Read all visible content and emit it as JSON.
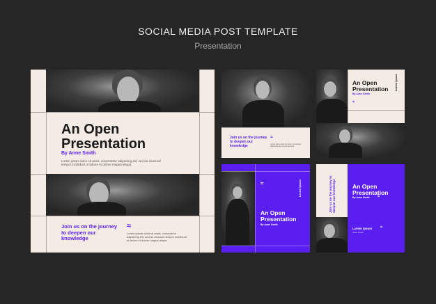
{
  "header": {
    "title": "SOCIAL MEDIA POST TEMPLATE",
    "subtitle": "Presentation"
  },
  "post_main": {
    "title_line1": "An Open",
    "title_line2": "Presentation",
    "author": "By Anne Smith",
    "body": "Lorem ipsum dolor sit amet, consectetur adipiscing elit, sed do eiusmod tempor incididunt ut labore et dolore magna aliqua.",
    "cta": "Join us on the journey to deepen our knowledge",
    "cta_body": "Lorem ipsum dolor sit amet, consectetur adipiscing elit, sed do eiusmod tempor incididunt ut labore et dolore magna aliqua.",
    "wave": "≈"
  },
  "post_top_middle": {
    "cta": "Join us on the journey to deepen our knowledge",
    "body": "Lorem ipsum dolor sit amet, consectetur adipiscing elit, sed do eiusmod.",
    "wave": "≈"
  },
  "post_top_right": {
    "title": "An Open Presentation",
    "author": "By Anne Smith",
    "vertical": "Lorem ipsum",
    "vertical_sub": "Anne Smith",
    "wave": "≈"
  },
  "post_bottom_middle": {
    "title": "An Open Presentation",
    "author": "By Anne Smith",
    "vertical": "Lorem ipsum",
    "vertical_sub": "Anne Smith",
    "wave": "≈"
  },
  "post_bottom_right": {
    "title": "An Open Presentation",
    "author": "By Anne Smith",
    "vertical": "Join us on the journey to deepen our knowledge",
    "footer": "Lorem ipsum",
    "footer_sub": "Anne Smith",
    "wave": "≈"
  }
}
